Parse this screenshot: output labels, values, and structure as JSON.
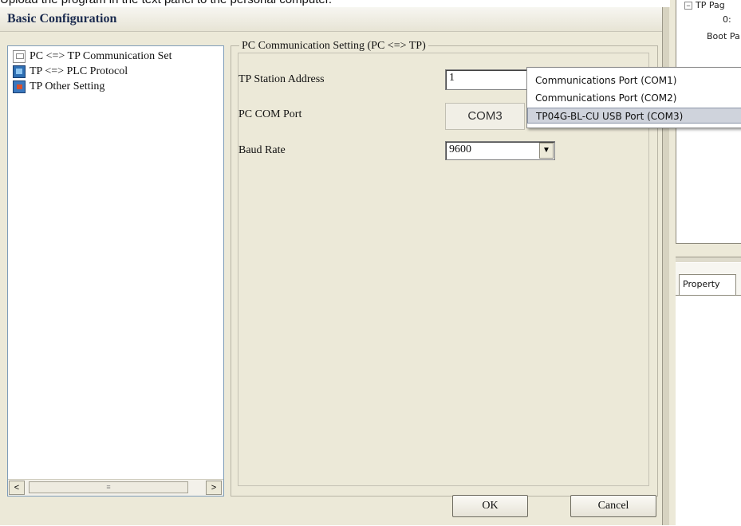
{
  "caption": "Upload the program in the text panel to the personal computer.",
  "dialog": {
    "title": "Basic Configuration",
    "ok_label": "OK",
    "cancel_label": "Cancel"
  },
  "tree": {
    "items": [
      {
        "label": "PC <=> TP Communication Set",
        "icon": "pc-icon"
      },
      {
        "label": "TP <=> PLC Protocol",
        "icon": "protocol-icon"
      },
      {
        "label": "TP Other Setting",
        "icon": "settings-icon"
      }
    ],
    "scroll_left": "<",
    "scroll_right": ">",
    "scroll_thumb": "≡"
  },
  "settings": {
    "group_title": "PC Communication Setting (PC <=> TP)",
    "station_label": "TP Station Address",
    "station_value": "1",
    "com_label": "PC COM Port",
    "com_value": "COM3",
    "baud_label": "Baud Rate",
    "baud_value": "9600"
  },
  "com_dropdown": {
    "options": [
      "Communications Port (COM1)",
      "Communications Port (COM2)",
      "TP04G-BL-CU USB Port (COM3)"
    ],
    "selected_index": 2
  },
  "side_panel": {
    "tree_root": "TP Pag",
    "tree_child": "0:",
    "tree_boot": "Boot Pa",
    "property_tab": "Property"
  },
  "colors": {
    "dialog_bg": "#ece9d8",
    "title_text": "#1b2b4f",
    "selection": "#cfd3dc"
  }
}
